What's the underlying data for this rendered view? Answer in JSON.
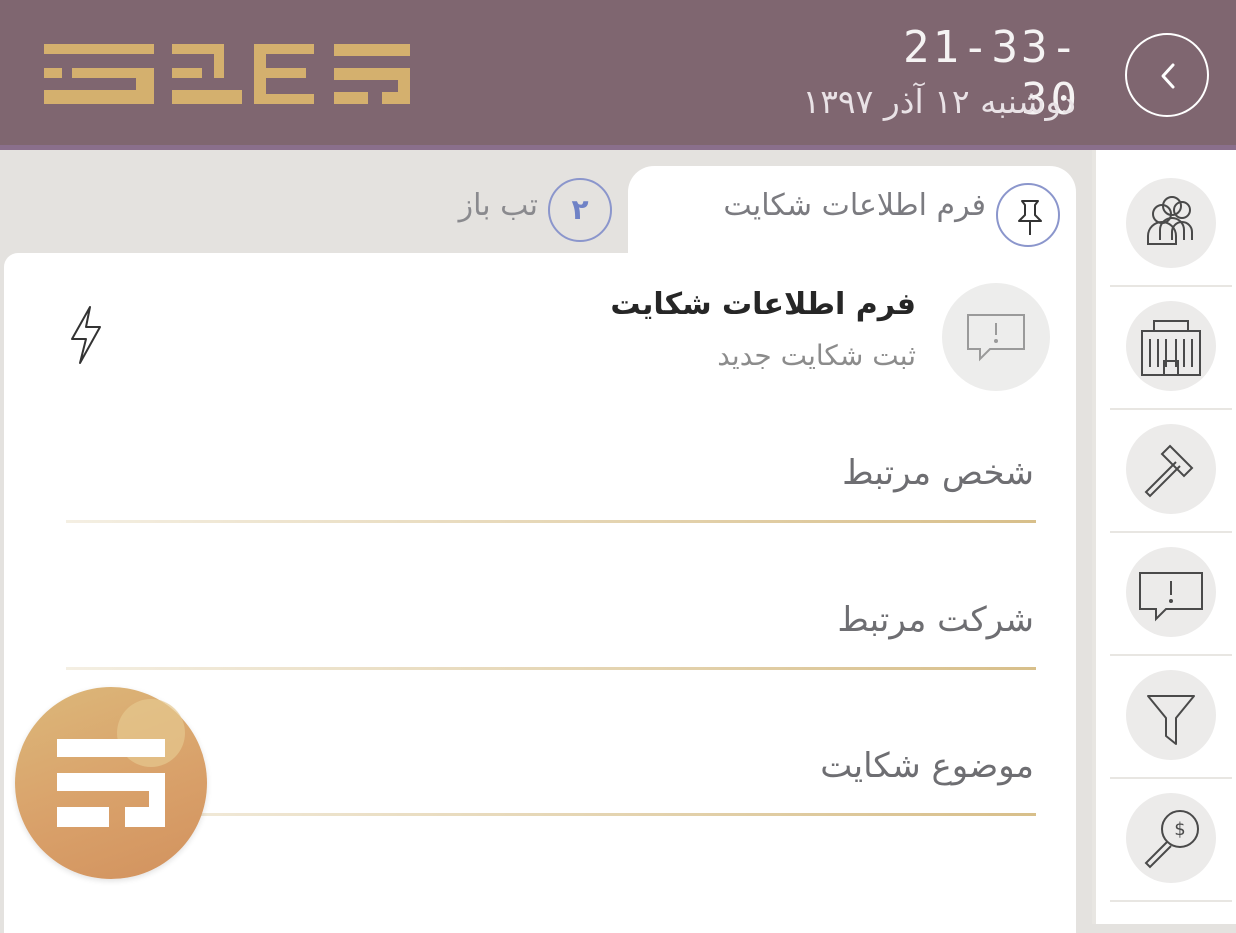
{
  "header": {
    "clock": "21-33-30",
    "date": "دوشنبه ۱۲ آذر ۱۳۹۷",
    "back_icon": "chevron-left-icon",
    "logo_icon": "brand-logo-icon"
  },
  "tabs": {
    "active_label": "فرم اطلاعات شکایت",
    "active_icon": "pin-icon",
    "open_count": "۲",
    "open_label": "تب باز"
  },
  "form": {
    "title": "فرم اطلاعات شکایت",
    "subtitle": "ثبت شکایت جدید",
    "icon": "complaint-icon",
    "action_icon": "lightning-icon",
    "fields": [
      {
        "label": "شخص مرتبط"
      },
      {
        "label": "شرکت مرتبط"
      },
      {
        "label": "موضوع شکایت"
      }
    ]
  },
  "sidebar": {
    "items": [
      {
        "icon": "people-icon"
      },
      {
        "icon": "building-icon"
      },
      {
        "icon": "hammer-icon"
      },
      {
        "icon": "complaint-icon"
      },
      {
        "icon": "filter-icon"
      },
      {
        "icon": "money-search-icon"
      }
    ]
  },
  "fab": {
    "icon": "brand-logo-icon"
  },
  "colors": {
    "header_bg": "#7f6670",
    "header_accent": "#8a6f8c",
    "logo_gold": "#d4b06e",
    "tab_accent": "#8b96cc",
    "field_line": "#d8bf8a",
    "fab_gold": "#d9a16a"
  }
}
